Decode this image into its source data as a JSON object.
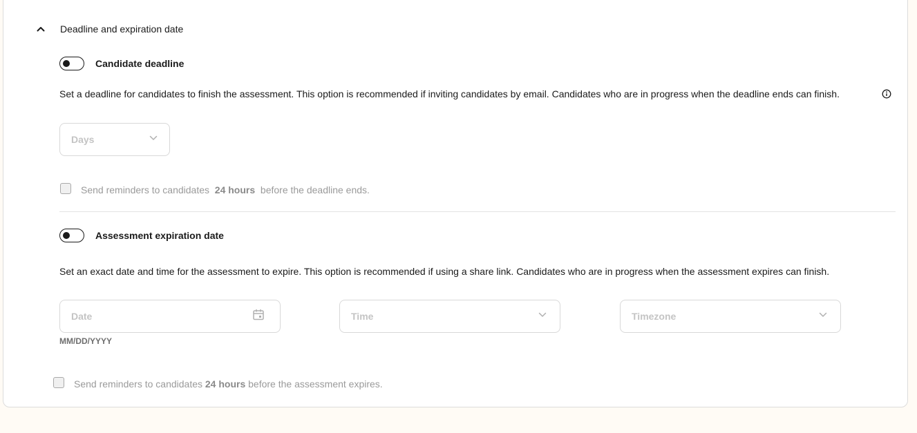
{
  "section": {
    "title": "Deadline and expiration date"
  },
  "candidate_deadline": {
    "label": "Candidate deadline",
    "description": "Set a deadline for candidates to finish the assessment. This option is recommended if inviting candidates by email. Candidates who are in progress when the deadline ends can finish.",
    "days_placeholder": "Days",
    "reminder_prefix": "Send reminders to candidates",
    "reminder_bold": "24 hours",
    "reminder_suffix": "before the deadline ends.",
    "enabled": false,
    "reminder_checked": false
  },
  "expiration": {
    "label": "Assessment expiration date",
    "description": "Set an exact date and time for the assessment to expire. This option is recommended if using a share link. Candidates who are in progress when the assessment expires can finish.",
    "date_placeholder": "Date",
    "date_hint": "MM/DD/YYYY",
    "time_placeholder": "Time",
    "timezone_placeholder": "Timezone",
    "reminder_prefix": "Send reminders to candidates",
    "reminder_bold": "24 hours",
    "reminder_suffix": "before the assessment expires.",
    "enabled": false,
    "reminder_checked": false
  },
  "icons": {
    "collapse": "chevron-up-icon",
    "info": "info-icon",
    "dropdown": "chevron-down-icon",
    "calendar": "calendar-icon"
  },
  "colors": {
    "page_background": "#fffbf5",
    "card_background": "#ffffff",
    "text_primary": "#1a1a1a",
    "text_disabled": "#9a9a9a",
    "placeholder": "#c4c4c4"
  }
}
